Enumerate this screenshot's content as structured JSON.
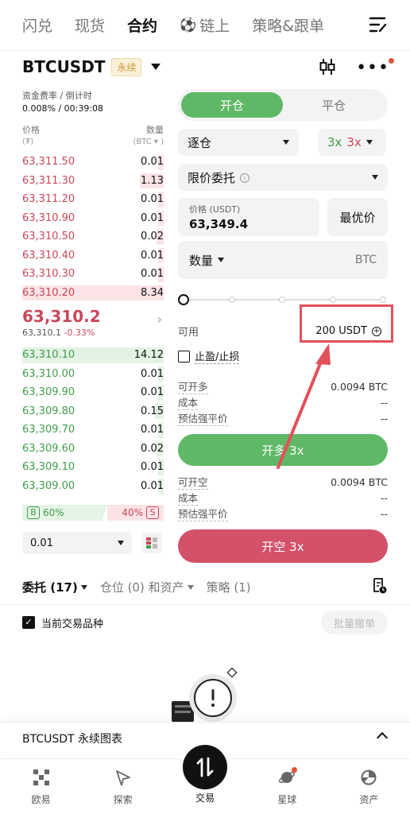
{
  "topnav": {
    "tabs": [
      {
        "label": "闪兑"
      },
      {
        "label": "现货"
      },
      {
        "label": "合约"
      },
      {
        "label": "链上"
      },
      {
        "label": "策略&跟单"
      }
    ]
  },
  "symbol": {
    "name": "BTCUSDT",
    "badge": "永续"
  },
  "orderbook": {
    "funding_label": "资金费率 / 倒计时",
    "funding_value": "0.008% / 00:39:08",
    "price_header": "价格",
    "price_unit": "(₮)",
    "qty_header": "数量",
    "qty_unit": "(BTC ▾ )",
    "asks": [
      {
        "price": "63,311.50",
        "qty": "0.01",
        "depth": 0.04
      },
      {
        "price": "63,311.30",
        "qty": "1.13",
        "depth": 0.17
      },
      {
        "price": "63,311.20",
        "qty": "0.01",
        "depth": 0.04
      },
      {
        "price": "63,310.90",
        "qty": "0.01",
        "depth": 0.04
      },
      {
        "price": "63,310.50",
        "qty": "0.02",
        "depth": 0.05
      },
      {
        "price": "63,310.40",
        "qty": "0.01",
        "depth": 0.04
      },
      {
        "price": "63,310.30",
        "qty": "0.01",
        "depth": 0.04
      },
      {
        "price": "63,310.20",
        "qty": "8.34",
        "depth": 1.0
      }
    ],
    "last_price": "63,310.2",
    "mark_price": "63,310.1",
    "change_pct": "-0.33%",
    "bids": [
      {
        "price": "63,310.10",
        "qty": "14.12",
        "depth": 1.0
      },
      {
        "price": "63,310.00",
        "qty": "0.01",
        "depth": 0.04
      },
      {
        "price": "63,309.90",
        "qty": "0.01",
        "depth": 0.04
      },
      {
        "price": "63,309.80",
        "qty": "0.15",
        "depth": 0.06
      },
      {
        "price": "63,309.70",
        "qty": "0.01",
        "depth": 0.04
      },
      {
        "price": "63,309.60",
        "qty": "0.02",
        "depth": 0.05
      },
      {
        "price": "63,309.10",
        "qty": "0.01",
        "depth": 0.04
      },
      {
        "price": "63,309.00",
        "qty": "0.01",
        "depth": 0.04
      }
    ],
    "buy_letter": "B",
    "sell_letter": "S",
    "buy_ratio": "60%",
    "sell_ratio": "40%",
    "precision": "0.01"
  },
  "form": {
    "open_tab": "开仓",
    "close_tab": "平仓",
    "margin_mode": "逐仓",
    "leverage_long": "3x",
    "leverage_short": "3x",
    "order_type": "限价委托",
    "price_label": "价格 (USDT)",
    "price_value": "63,349.4",
    "best_price": "最优价",
    "qty_label": "数量",
    "qty_unit": "BTC",
    "slider_position": 0,
    "available_label": "可用",
    "available_value": "200 USDT",
    "tpsl_label": "止盈/止损",
    "long_max_label": "可开多",
    "long_max_value": "0.0094 BTC",
    "long_cost_label": "成本",
    "long_cost_value": "--",
    "long_liq_label": "预估强平价",
    "long_liq_value": "--",
    "long_button": "开多 3x",
    "short_max_label": "可开空",
    "short_max_value": "0.0094 BTC",
    "short_cost_label": "成本",
    "short_cost_value": "--",
    "short_liq_label": "预估强平价",
    "short_liq_value": "--",
    "short_button": "开空 3x"
  },
  "orders": {
    "tab_orders": "委托 (17)",
    "tab_positions": "仓位 (0) 和资产",
    "tab_strategy": "策略 (1)",
    "filter_label": "当前交易品种",
    "batch_cancel": "批量撤单"
  },
  "chart_drawer": {
    "title": "BTCUSDT 永续图表"
  },
  "bottom_nav": {
    "items": [
      {
        "label": "欧易"
      },
      {
        "label": "探索"
      },
      {
        "label": "交易"
      },
      {
        "label": "星球"
      },
      {
        "label": "资产"
      }
    ]
  },
  "colors": {
    "green": "#5fb865",
    "red": "#d4516a",
    "annotation": "#e2505a"
  }
}
